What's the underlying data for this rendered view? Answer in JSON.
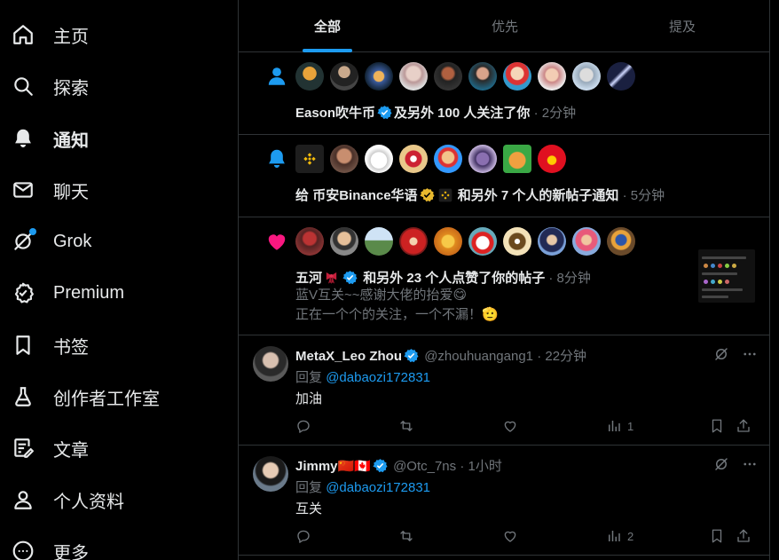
{
  "sidebar": {
    "items": [
      {
        "label": "主页",
        "icon": "home-icon"
      },
      {
        "label": "探索",
        "icon": "search-icon"
      },
      {
        "label": "通知",
        "icon": "bell-icon"
      },
      {
        "label": "聊天",
        "icon": "mail-icon"
      },
      {
        "label": "Grok",
        "icon": "grok-icon"
      },
      {
        "label": "Premium",
        "icon": "premium-badge-icon"
      },
      {
        "label": "书签",
        "icon": "bookmark-icon"
      },
      {
        "label": "创作者工作室",
        "icon": "flask-icon"
      },
      {
        "label": "文章",
        "icon": "article-icon"
      },
      {
        "label": "个人资料",
        "icon": "person-icon"
      },
      {
        "label": "更多",
        "icon": "more-circle-icon"
      }
    ]
  },
  "tabs": [
    {
      "label": "全部"
    },
    {
      "label": "优先"
    },
    {
      "label": "提及"
    }
  ],
  "notifications": {
    "follow": {
      "name": "Eason吹牛币",
      "text": "及另外 100 人关注了你",
      "time": "· 2分钟"
    },
    "post": {
      "prefix": "给",
      "name": "币安Binance华语",
      "text": "和另外 7 个人的新帖子通知",
      "time": "· 5分钟"
    },
    "like": {
      "name": "五河",
      "text": "和另外 23 个人点赞了你的帖子",
      "time": "· 8分钟",
      "post_line1": "蓝V互关~~感谢大佬的抬爱😋",
      "post_line2": "正在一个个的关注，一个不漏！🫡"
    }
  },
  "replies": [
    {
      "name": "MetaX_Leo Zhou",
      "handle": "@zhouhuangang1",
      "time": "· 22分钟",
      "reply_label": "回复",
      "reply_to": "@dabaozi172831",
      "body": "加油",
      "views": "1"
    },
    {
      "name": "Jimmy🇨🇳🇨🇦",
      "handle": "@Otc_7ns",
      "time": "· 1小时",
      "reply_label": "回复",
      "reply_to": "@dabaozi172831",
      "body": "互关",
      "views": "2"
    }
  ],
  "colors": {
    "accent": "#1d9bf0",
    "like": "#f91880",
    "gold": "#e8b92e",
    "border": "#2f3336",
    "muted": "#71767b"
  }
}
